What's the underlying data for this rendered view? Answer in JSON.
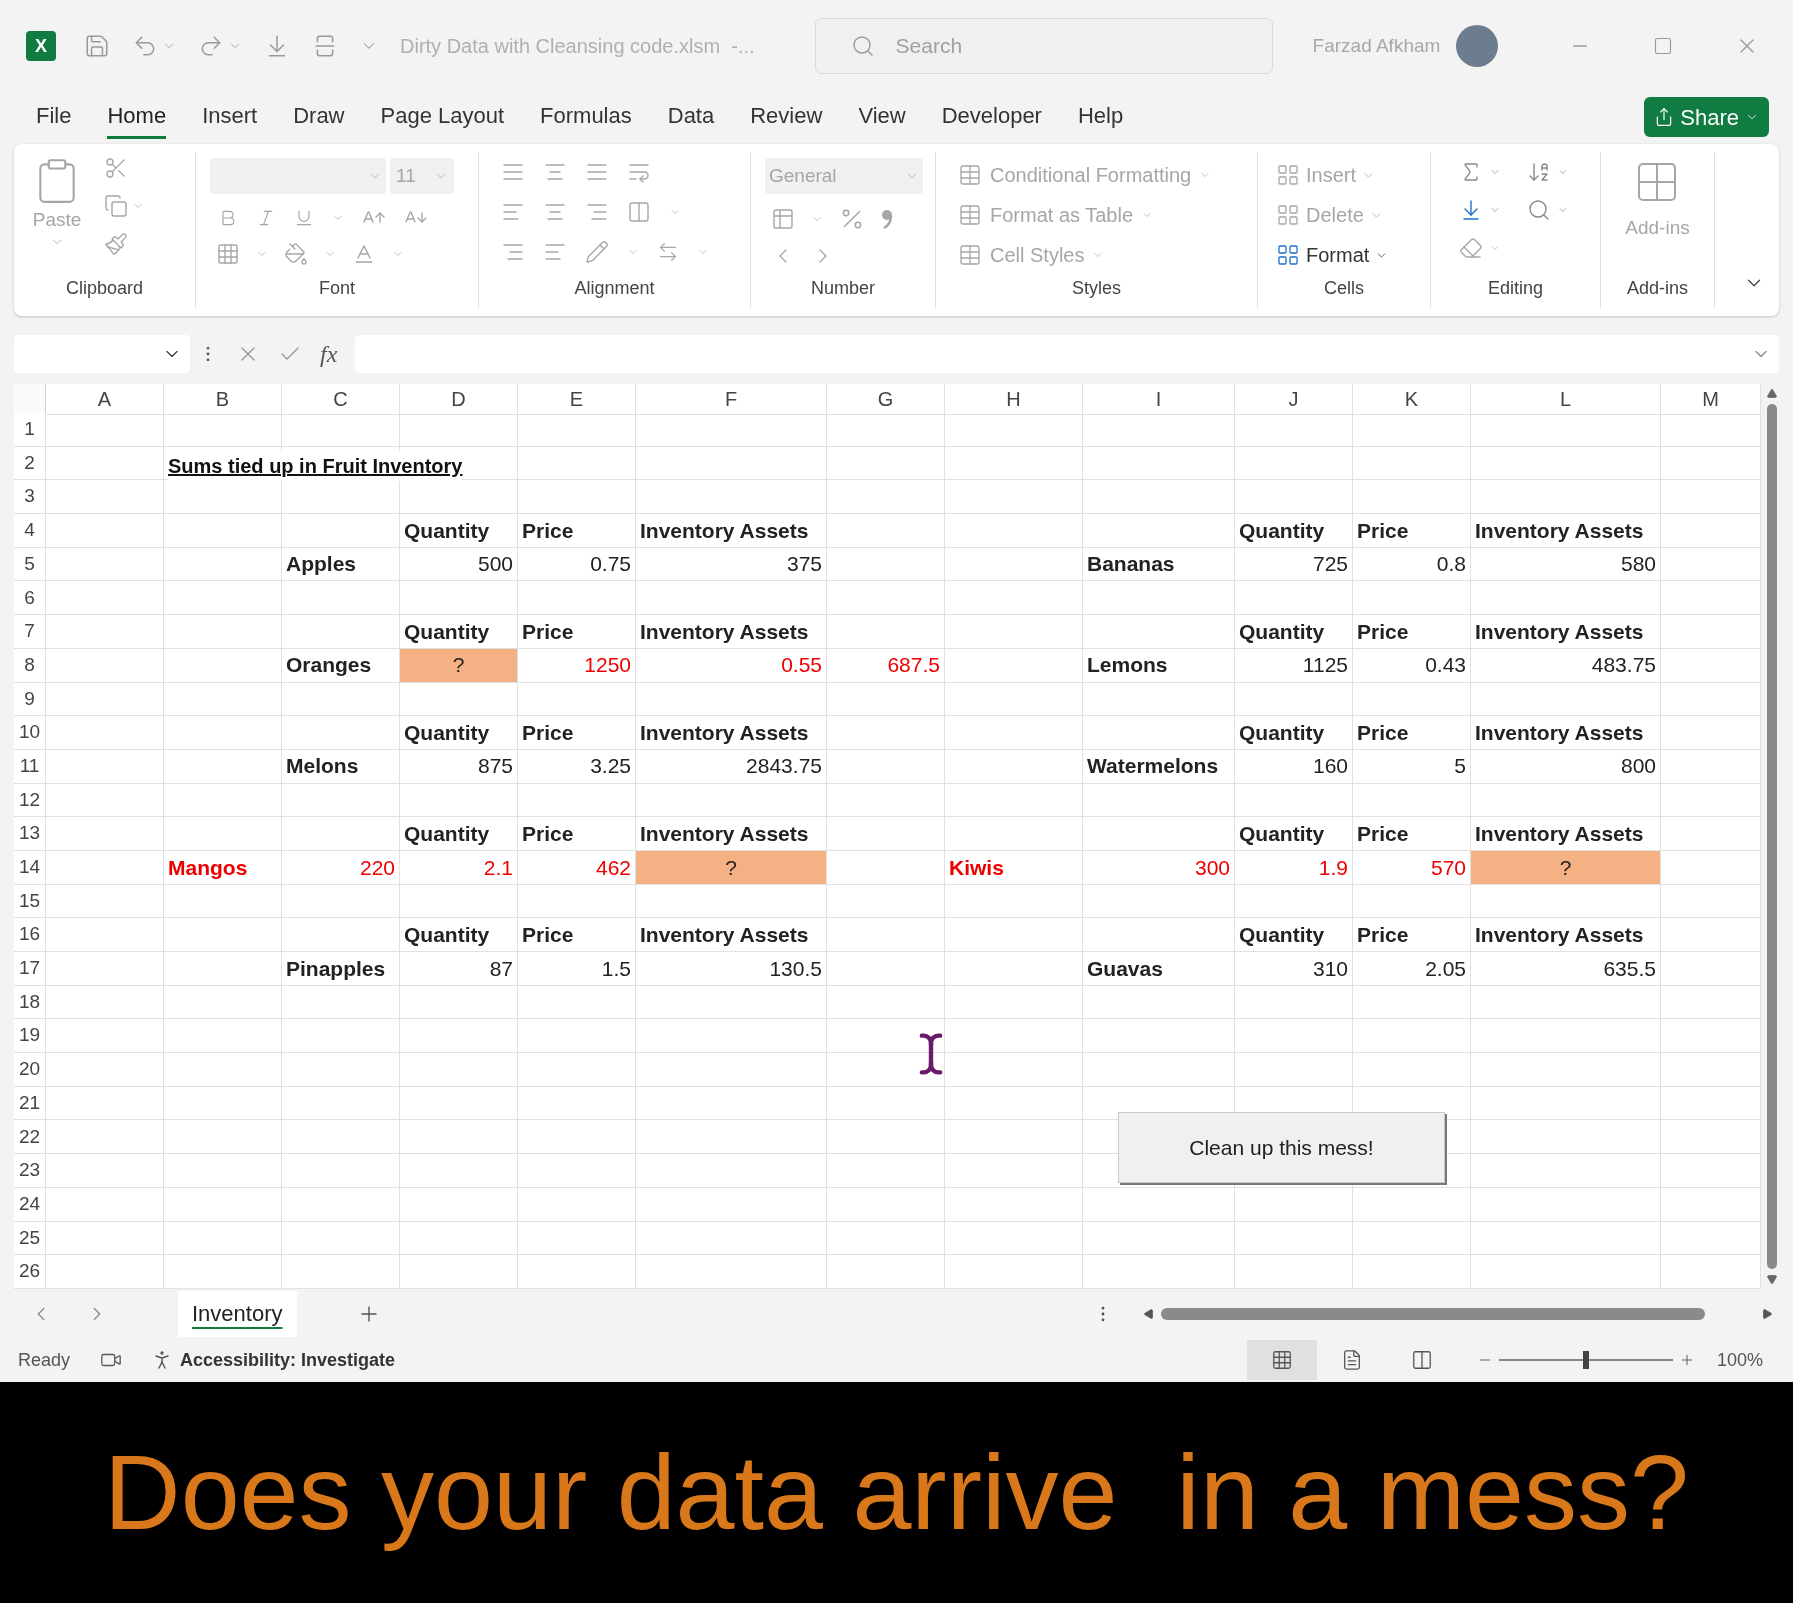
{
  "title_bar": {
    "logo_letter": "X",
    "file_name": "Dirty Data with Cleansing code.xlsm  -...",
    "search": {
      "placeholder": "Search"
    },
    "user_name": "Farzad Afkham"
  },
  "tabs": [
    {
      "label": "File",
      "selected": false
    },
    {
      "label": "Home",
      "selected": true
    },
    {
      "label": "Insert",
      "selected": false
    },
    {
      "label": "Draw",
      "selected": false
    },
    {
      "label": "Page Layout",
      "selected": false
    },
    {
      "label": "Formulas",
      "selected": false
    },
    {
      "label": "Data",
      "selected": false
    },
    {
      "label": "Review",
      "selected": false
    },
    {
      "label": "View",
      "selected": false
    },
    {
      "label": "Developer",
      "selected": false
    },
    {
      "label": "Help",
      "selected": false
    }
  ],
  "share_button": {
    "label": "Share"
  },
  "ribbon": {
    "groups": [
      {
        "kind": "clipboard",
        "label": "Clipboard",
        "paste": {
          "label": "Paste",
          "disabled": true
        }
      },
      {
        "kind": "font",
        "label": "Font",
        "font_size": "11"
      },
      {
        "kind": "alignment",
        "label": "Alignment"
      },
      {
        "kind": "number",
        "label": "Number",
        "format": "General"
      },
      {
        "kind": "styles",
        "label": "Styles",
        "items": [
          {
            "label": "Conditional Formatting",
            "disabled": true
          },
          {
            "label": "Format as Table",
            "disabled": true
          },
          {
            "label": "Cell Styles",
            "disabled": true
          }
        ]
      },
      {
        "kind": "cells",
        "label": "Cells",
        "items": [
          {
            "label": "Insert",
            "disabled": true
          },
          {
            "label": "Delete",
            "disabled": true
          },
          {
            "label": "Format",
            "disabled": false
          }
        ]
      },
      {
        "kind": "editing",
        "label": "Editing"
      },
      {
        "kind": "addins",
        "label": "Add-ins",
        "button": {
          "label": "Add-ins",
          "disabled": true
        }
      }
    ]
  },
  "formula_bar": {
    "function_label": "fx"
  },
  "sheet": {
    "columns": [
      "A",
      "B",
      "C",
      "D",
      "E",
      "F",
      "G",
      "H",
      "I",
      "J",
      "K",
      "L",
      "M"
    ],
    "rows": [
      {
        "number": "1"
      },
      {
        "number": "2",
        "cells": {
          "B": {
            "text": "Sums tied up in Fruit Inventory",
            "kind": "title"
          }
        }
      },
      {
        "number": "3"
      },
      {
        "number": "4",
        "cells": {
          "D": {
            "text": "Quantity",
            "kind": "heading"
          },
          "E": {
            "text": "Price",
            "kind": "heading"
          },
          "F": {
            "text": "Inventory Assets",
            "kind": "heading"
          },
          "J": {
            "text": "Quantity",
            "kind": "heading"
          },
          "K": {
            "text": "Price",
            "kind": "heading"
          },
          "L": {
            "text": "Inventory Assets",
            "kind": "heading"
          }
        }
      },
      {
        "number": "5",
        "cells": {
          "C": {
            "text": "Apples",
            "kind": "label"
          },
          "D": {
            "text": "500",
            "kind": "value"
          },
          "E": {
            "text": "0.75",
            "kind": "value"
          },
          "F": {
            "text": "375",
            "kind": "value"
          },
          "I": {
            "text": "Bananas",
            "kind": "label"
          },
          "J": {
            "text": "725",
            "kind": "value"
          },
          "K": {
            "text": "0.8",
            "kind": "value"
          },
          "L": {
            "text": "580",
            "kind": "value"
          }
        }
      },
      {
        "number": "6"
      },
      {
        "number": "7",
        "cells": {
          "D": {
            "text": "Quantity",
            "kind": "heading"
          },
          "E": {
            "text": "Price",
            "kind": "heading"
          },
          "F": {
            "text": "Inventory Assets",
            "kind": "heading"
          },
          "J": {
            "text": "Quantity",
            "kind": "heading"
          },
          "K": {
            "text": "Price",
            "kind": "heading"
          },
          "L": {
            "text": "Inventory Assets",
            "kind": "heading"
          }
        }
      },
      {
        "number": "8",
        "cells": {
          "C": {
            "text": "Oranges",
            "kind": "label"
          },
          "D": {
            "text": "?",
            "kind": "missing"
          },
          "E": {
            "text": "1250",
            "kind": "flagged_value"
          },
          "F": {
            "text": "0.55",
            "kind": "flagged_value"
          },
          "G": {
            "text": "687.5",
            "kind": "flagged_value"
          },
          "I": {
            "text": "Lemons",
            "kind": "label"
          },
          "J": {
            "text": "1125",
            "kind": "value"
          },
          "K": {
            "text": "0.43",
            "kind": "value"
          },
          "L": {
            "text": "483.75",
            "kind": "value"
          }
        }
      },
      {
        "number": "9"
      },
      {
        "number": "10",
        "cells": {
          "D": {
            "text": "Quantity",
            "kind": "heading"
          },
          "E": {
            "text": "Price",
            "kind": "heading"
          },
          "F": {
            "text": "Inventory Assets",
            "kind": "heading"
          },
          "J": {
            "text": "Quantity",
            "kind": "heading"
          },
          "K": {
            "text": "Price",
            "kind": "heading"
          },
          "L": {
            "text": "Inventory Assets",
            "kind": "heading"
          }
        }
      },
      {
        "number": "11",
        "cells": {
          "C": {
            "text": "Melons",
            "kind": "label"
          },
          "D": {
            "text": "875",
            "kind": "value"
          },
          "E": {
            "text": "3.25",
            "kind": "value"
          },
          "F": {
            "text": "2843.75",
            "kind": "value"
          },
          "I": {
            "text": "Watermelons",
            "kind": "label"
          },
          "J": {
            "text": "160",
            "kind": "value"
          },
          "K": {
            "text": "5",
            "kind": "value"
          },
          "L": {
            "text": "800",
            "kind": "value"
          }
        }
      },
      {
        "number": "12"
      },
      {
        "number": "13",
        "cells": {
          "D": {
            "text": "Quantity",
            "kind": "heading"
          },
          "E": {
            "text": "Price",
            "kind": "heading"
          },
          "F": {
            "text": "Inventory Assets",
            "kind": "heading"
          },
          "J": {
            "text": "Quantity",
            "kind": "heading"
          },
          "K": {
            "text": "Price",
            "kind": "heading"
          },
          "L": {
            "text": "Inventory Assets",
            "kind": "heading"
          }
        }
      },
      {
        "number": "14",
        "cells": {
          "B": {
            "text": "Mangos",
            "kind": "flagged_label"
          },
          "C": {
            "text": "220",
            "kind": "flagged_value"
          },
          "D": {
            "text": "2.1",
            "kind": "flagged_value"
          },
          "E": {
            "text": "462",
            "kind": "flagged_value"
          },
          "F": {
            "text": "?",
            "kind": "missing"
          },
          "H": {
            "text": "Kiwis",
            "kind": "flagged_label"
          },
          "I": {
            "text": "300",
            "kind": "flagged_value"
          },
          "J": {
            "text": "1.9",
            "kind": "flagged_value"
          },
          "K": {
            "text": "570",
            "kind": "flagged_value"
          },
          "L": {
            "text": "?",
            "kind": "missing"
          }
        }
      },
      {
        "number": "15"
      },
      {
        "number": "16",
        "cells": {
          "D": {
            "text": "Quantity",
            "kind": "heading"
          },
          "E": {
            "text": "Price",
            "kind": "heading"
          },
          "F": {
            "text": "Inventory Assets",
            "kind": "heading"
          },
          "J": {
            "text": "Quantity",
            "kind": "heading"
          },
          "K": {
            "text": "Price",
            "kind": "heading"
          },
          "L": {
            "text": "Inventory Assets",
            "kind": "heading"
          }
        }
      },
      {
        "number": "17",
        "cells": {
          "C": {
            "text": "Pinapples",
            "kind": "label"
          },
          "D": {
            "text": "87",
            "kind": "value"
          },
          "E": {
            "text": "1.5",
            "kind": "value"
          },
          "F": {
            "text": "130.5",
            "kind": "value"
          },
          "I": {
            "text": "Guavas",
            "kind": "label"
          },
          "J": {
            "text": "310",
            "kind": "value"
          },
          "K": {
            "text": "2.05",
            "kind": "value"
          },
          "L": {
            "text": "635.5",
            "kind": "value"
          }
        }
      },
      {
        "number": "18"
      },
      {
        "number": "19"
      },
      {
        "number": "20"
      },
      {
        "number": "21"
      },
      {
        "number": "22"
      },
      {
        "number": "23"
      },
      {
        "number": "24"
      },
      {
        "number": "25"
      },
      {
        "number": "26"
      }
    ],
    "macro_button": {
      "label": "Clean up this mess!"
    }
  },
  "sheet_tabs": [
    {
      "label": "Inventory",
      "selected": true
    }
  ],
  "status_bar": {
    "ready": "Ready",
    "accessibility": "Accessibility: Investigate",
    "views": [
      {
        "kind": "normal",
        "selected": true
      },
      {
        "kind": "page_layout",
        "selected": false
      },
      {
        "kind": "page_break",
        "selected": false
      }
    ],
    "zoom": {
      "level": 0.5,
      "reading": "100%"
    }
  },
  "caption": "Does your data arrive  in a mess?"
}
